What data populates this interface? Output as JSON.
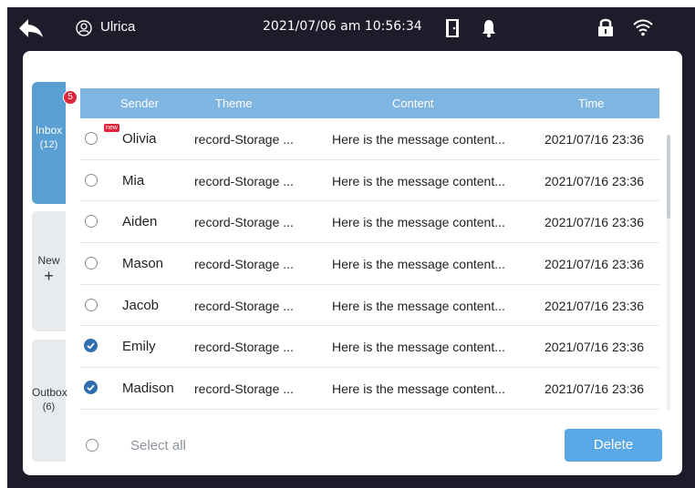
{
  "statusbar": {
    "user_name": "Ulrica",
    "datetime": "2021/07/06 am 10:56:34"
  },
  "tabs": {
    "inbox": {
      "label": "Inbox",
      "count": "(12)",
      "badge": "5"
    },
    "new": {
      "label": "New",
      "plus": "+"
    },
    "outbox": {
      "label": "Outbox",
      "count": "(6)"
    }
  },
  "table": {
    "headers": {
      "sender": "Sender",
      "theme": "Theme",
      "content": "Content",
      "time": "Time"
    },
    "rows": [
      {
        "sender": "Olivia",
        "theme": "record-Storage ...",
        "content": "Here is the message content...",
        "time": "2021/07/16  23:36",
        "checked": false,
        "new_tag": "new"
      },
      {
        "sender": "Mia",
        "theme": "record-Storage ...",
        "content": "Here is the message content...",
        "time": "2021/07/16  23:36",
        "checked": false
      },
      {
        "sender": "Aiden",
        "theme": "record-Storage ...",
        "content": "Here is the message content...",
        "time": "2021/07/16  23:36",
        "checked": false
      },
      {
        "sender": "Mason",
        "theme": "record-Storage ...",
        "content": "Here is the message content...",
        "time": "2021/07/16  23:36",
        "checked": false
      },
      {
        "sender": "Jacob",
        "theme": "record-Storage ...",
        "content": "Here is the message content...",
        "time": "2021/07/16  23:36",
        "checked": false
      },
      {
        "sender": "Emily",
        "theme": "record-Storage ...",
        "content": "Here is the message content...",
        "time": "2021/07/16  23:36",
        "checked": true
      },
      {
        "sender": "Madison",
        "theme": "record-Storage ...",
        "content": "Here is the message content...",
        "time": "2021/07/16  23:36",
        "checked": true
      }
    ]
  },
  "footer": {
    "select_all": "Select all",
    "delete_label": "Delete"
  },
  "colors": {
    "accent": "#5a9fd4",
    "header": "#7fb5e1",
    "badge": "#e0243a",
    "background": "#1c1c2a"
  },
  "icons": [
    "back-arrow-icon",
    "user-icon",
    "door-icon",
    "bell-icon",
    "lock-icon",
    "wifi-icon",
    "checkbox-checked-icon"
  ]
}
